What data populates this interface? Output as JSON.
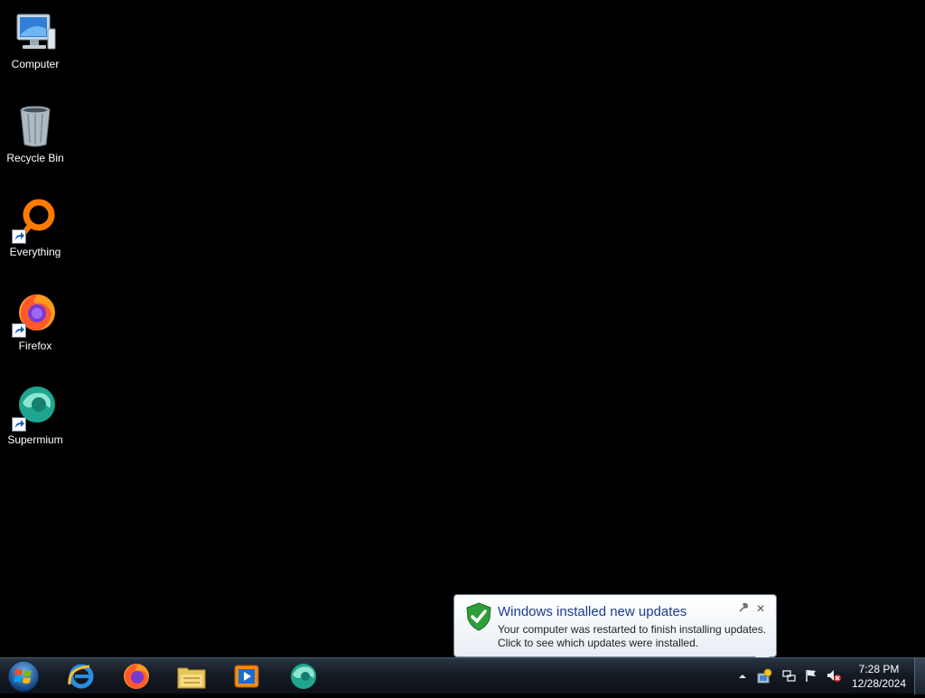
{
  "desktop": {
    "icons": [
      {
        "label": "Computer",
        "icon": "computer-icon"
      },
      {
        "label": "Recycle Bin",
        "icon": "recycle-bin-icon"
      },
      {
        "label": "Everything",
        "icon": "everything-icon"
      },
      {
        "label": "Firefox",
        "icon": "firefox-icon"
      },
      {
        "label": "Supermium",
        "icon": "supermium-icon"
      }
    ]
  },
  "notification": {
    "title": "Windows installed new updates",
    "line1": "Your computer was restarted to finish installing updates.",
    "line2": "Click to see which updates were installed.",
    "close_glyph": "✕"
  },
  "taskbar": {
    "start_icon": "windows-orb-icon",
    "pinned": [
      {
        "name": "internet-explorer",
        "icon": "internet-explorer-icon"
      },
      {
        "name": "firefox",
        "icon": "firefox-icon"
      },
      {
        "name": "file-explorer",
        "icon": "folder-icon"
      },
      {
        "name": "media-player",
        "icon": "media-player-icon"
      },
      {
        "name": "supermium",
        "icon": "supermium-icon"
      }
    ],
    "tray": {
      "time": "7:28 PM",
      "date": "12/28/2024",
      "icons": [
        "show-hidden-icons-arrow",
        "windows-update-icon",
        "network-icon",
        "action-center-flag-icon",
        "volume-muted-icon"
      ]
    }
  },
  "colors": {
    "desktop_bg": "#000000",
    "balloon_title": "#1e3b8a",
    "shield_green": "#2f9e3a"
  }
}
